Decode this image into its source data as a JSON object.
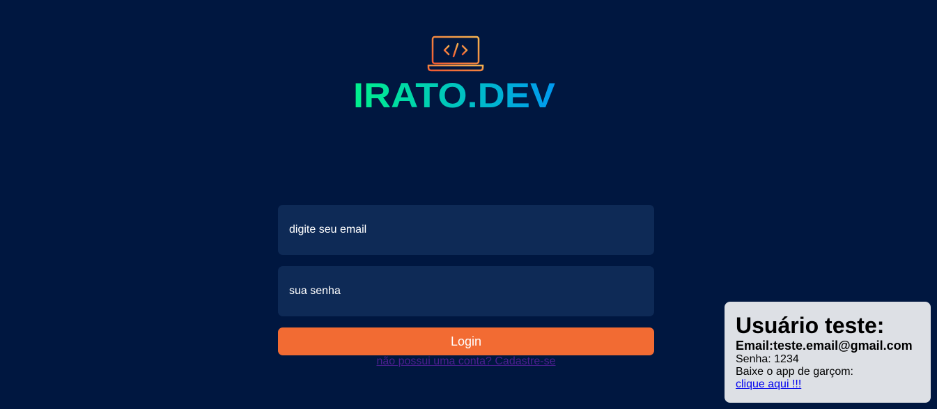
{
  "brand": {
    "name": "IRATO.DEV",
    "logo_icon": "laptop-code-icon",
    "gradient_start": "#00f08c",
    "gradient_end": "#0099f0",
    "icon_gradient_start": "#f05a32",
    "icon_gradient_end": "#f5b450"
  },
  "login_form": {
    "email_placeholder": "digite seu email",
    "password_placeholder": "sua senha",
    "login_button_label": "Login",
    "register_link_label": "não possui uma conta? Cadastre-se",
    "button_color": "#f26b33",
    "input_background": "#0e2a56"
  },
  "test_user_card": {
    "title": "Usuário teste:",
    "email_line": "Email:teste.email@gmail.com",
    "password_line": "Senha: 1234",
    "app_line": "Baixe o app de garçom:",
    "app_link_label": "clique aqui !!!"
  },
  "colors": {
    "page_background": "#001740",
    "card_background": "#dde0e5"
  }
}
